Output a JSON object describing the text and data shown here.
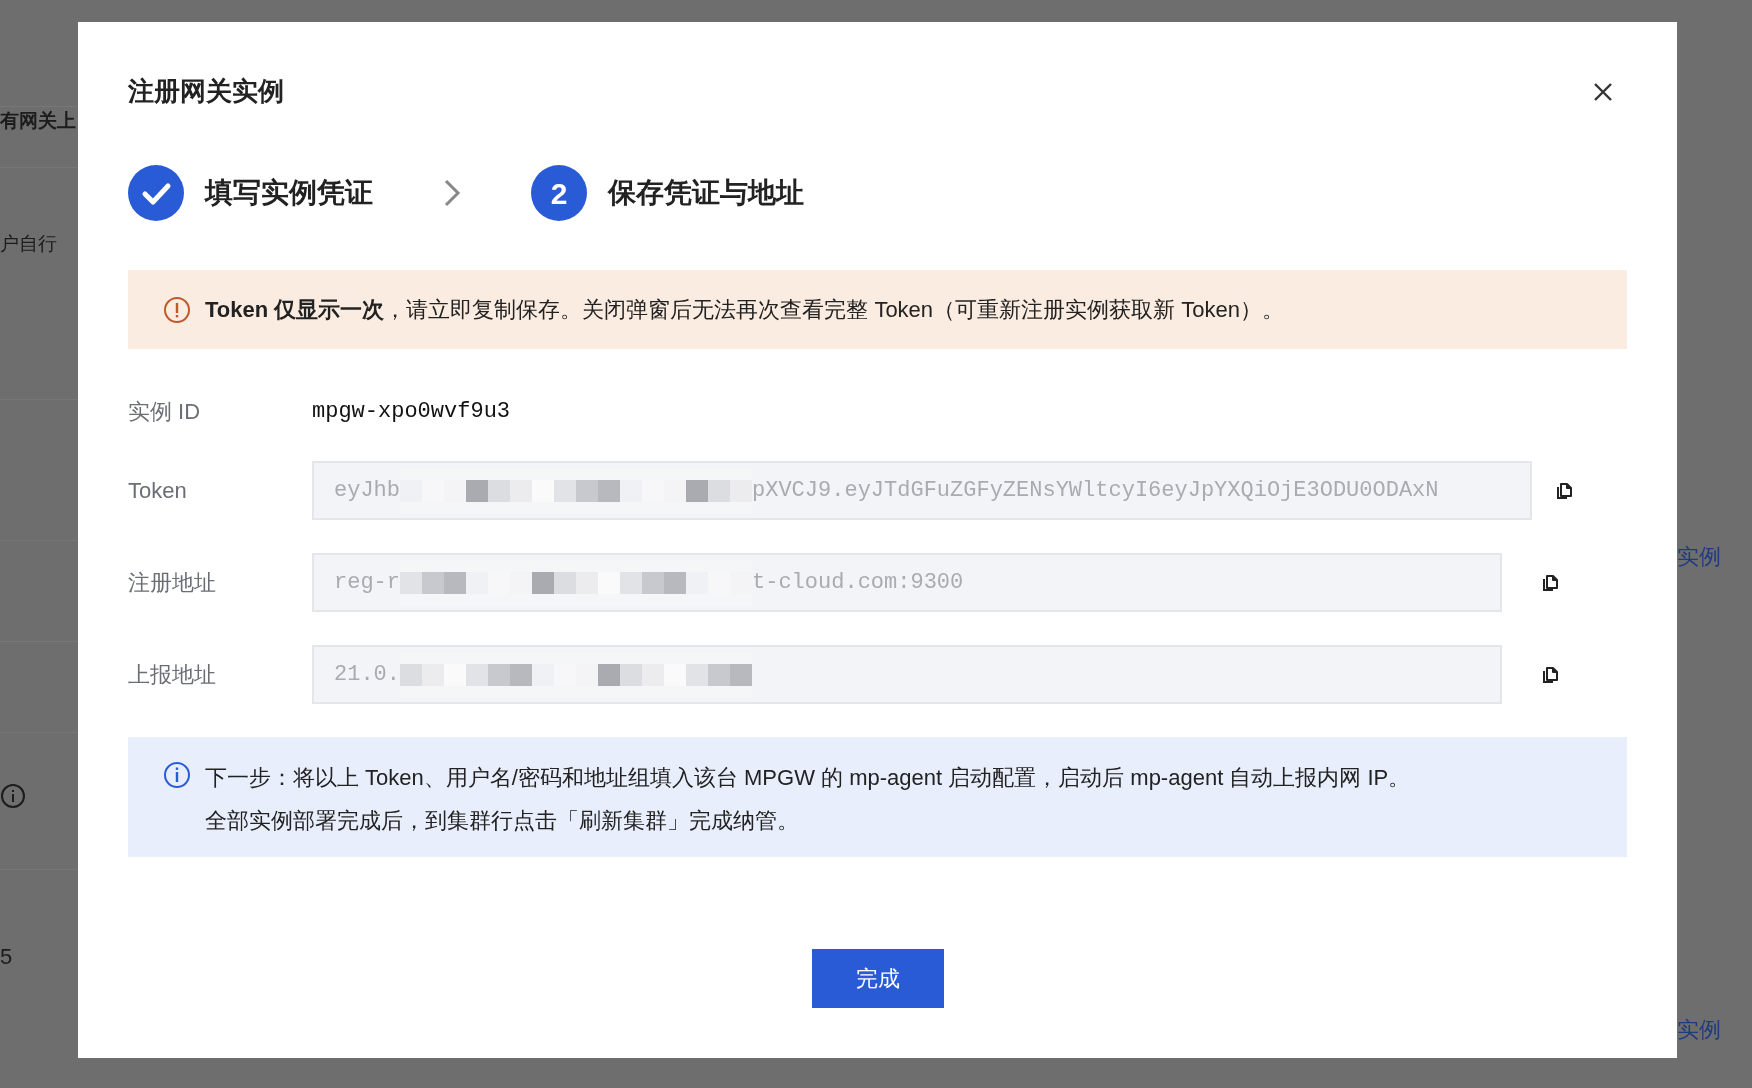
{
  "background_page": {
    "left_texts": [
      "有网关上",
      "户自行"
    ],
    "left_footer": "5",
    "right_rows": [
      {
        "link_1": "实例"
      },
      {
        "link_1": "实例"
      }
    ]
  },
  "dialog": {
    "title": "注册网关实例",
    "steps": [
      {
        "kind": "check",
        "label": "填写实例凭证"
      },
      {
        "kind": "number",
        "number": "2",
        "label": "保存凭证与地址"
      }
    ],
    "warning": "**Token 仅显示一次**，请立即复制保存。关闭弹窗后无法再次查看完整 Token（可重新注册实例获取新 Token）。",
    "fields": [
      {
        "kind": "text",
        "label": "实例 ID",
        "value": "mpgw-xpo0wvf9u3"
      },
      {
        "kind": "field",
        "label": "Token",
        "value_start": "eyJhb",
        "value_end": "pXVCJ9.eyJTdGFuZGFyZENsYWltcyI6eyJpYXQiOjE3ODU0ODAxN",
        "wide": true,
        "redacted": true
      },
      {
        "kind": "field",
        "label": "注册地址",
        "value_start": "reg-r",
        "value_end": "t-cloud.com:9300",
        "wide": false,
        "redacted": true
      },
      {
        "kind": "field",
        "label": "上报地址",
        "value_start": "21.0.",
        "wide": false,
        "redacted": true
      }
    ],
    "info_lines": [
      "下一步：将以上 Token、用户名/密码和地址组填入该台 MPGW 的 mp-agent 启动配置，启动后 mp-agent 自动上报内网 IP。",
      "全部实例部署完成后，到集群行点击「刷新集群」完成纳管。"
    ],
    "button": "完成"
  }
}
